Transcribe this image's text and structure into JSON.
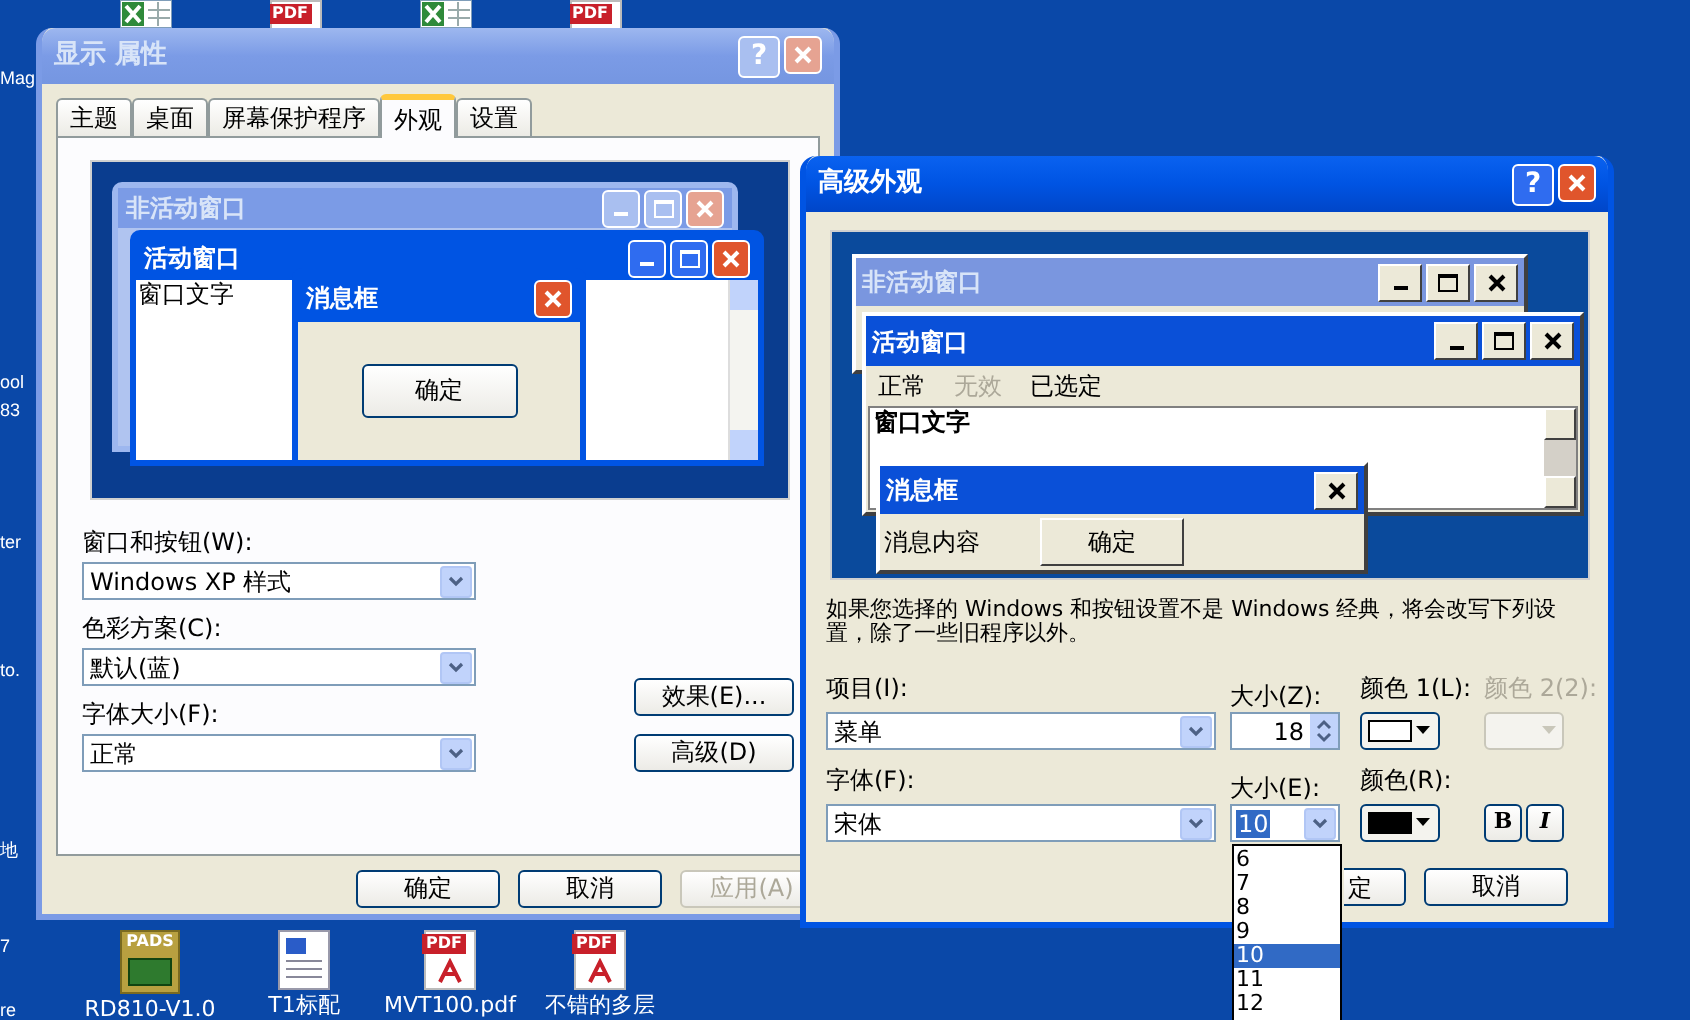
{
  "desktop": {
    "left_labels": [
      "Mag",
      "ool",
      "83",
      "ter",
      "to.",
      "地",
      "7",
      "re"
    ],
    "top_icons": [
      {
        "kind": "spreadsheet"
      },
      {
        "kind": "pdf",
        "badge": "PDF"
      },
      {
        "kind": "spreadsheet"
      },
      {
        "kind": "pdf",
        "badge": "PDF"
      }
    ],
    "bottom_icons": [
      {
        "kind": "board",
        "badge": "PADS",
        "label": "RD810-V1.0"
      },
      {
        "kind": "document",
        "label": "T1标配"
      },
      {
        "kind": "pdf",
        "badge": "PDF",
        "label": "MVT100.pdf"
      },
      {
        "kind": "pdf",
        "badge": "PDF",
        "label": "不错的多层"
      }
    ]
  },
  "display_properties": {
    "title": "显示 属性",
    "active": false,
    "help": "?",
    "tabs": [
      {
        "label": "主题",
        "selected": false
      },
      {
        "label": "桌面",
        "selected": false
      },
      {
        "label": "屏幕保护程序",
        "selected": false
      },
      {
        "label": "外观",
        "selected": true
      },
      {
        "label": "设置",
        "selected": false
      }
    ],
    "preview": {
      "inactive_title": "非活动窗口",
      "active_title": "活动窗口",
      "window_text": "窗口文字",
      "message_title": "消息框",
      "ok": "确定"
    },
    "fields": [
      {
        "label": "窗口和按钮(W):",
        "value": "Windows XP 样式"
      },
      {
        "label": "色彩方案(C):",
        "value": "默认(蓝)"
      },
      {
        "label": "字体大小(F):",
        "value": "正常"
      }
    ],
    "side_buttons": [
      "效果(E)...",
      "高级(D)"
    ],
    "buttons": [
      {
        "label": "确定",
        "disabled": false
      },
      {
        "label": "取消",
        "disabled": false
      },
      {
        "label": "应用(A)",
        "disabled": true
      }
    ]
  },
  "advanced_appearance": {
    "title": "高级外观",
    "active": true,
    "help": "?",
    "preview": {
      "inactive_title": "非活动窗口",
      "active_title": "活动窗口",
      "menu": [
        {
          "label": "正常",
          "disabled": false
        },
        {
          "label": "无效",
          "disabled": true
        },
        {
          "label": "已选定",
          "disabled": false
        }
      ],
      "window_text": "窗口文字",
      "message_title": "消息框",
      "message_text": "消息内容",
      "ok": "确定"
    },
    "description": "如果您选择的 Windows 和按钮设置不是 Windows 经典，将会改写下列设置，除了一些旧程序以外。",
    "item": {
      "label": "项目(I):",
      "value": "菜单"
    },
    "size": {
      "label": "大小(Z):",
      "value": "18"
    },
    "color1": {
      "label": "颜色 1(L):",
      "color": "#ffffff"
    },
    "color2": {
      "label": "颜色 2(2):",
      "disabled": true
    },
    "font": {
      "label": "字体(F):",
      "value": "宋体"
    },
    "font_size": {
      "label": "大小(E):",
      "value": "10"
    },
    "font_color": {
      "label": "颜色(R):",
      "color": "#000000"
    },
    "style_buttons": [
      "B",
      "I"
    ],
    "size_options": [
      {
        "label": "6",
        "selected": false
      },
      {
        "label": "7",
        "selected": false
      },
      {
        "label": "8",
        "selected": false
      },
      {
        "label": "9",
        "selected": false
      },
      {
        "label": "10",
        "selected": true
      },
      {
        "label": "11",
        "selected": false
      },
      {
        "label": "12",
        "selected": false
      }
    ],
    "buttons": [
      "定",
      "取消"
    ]
  }
}
